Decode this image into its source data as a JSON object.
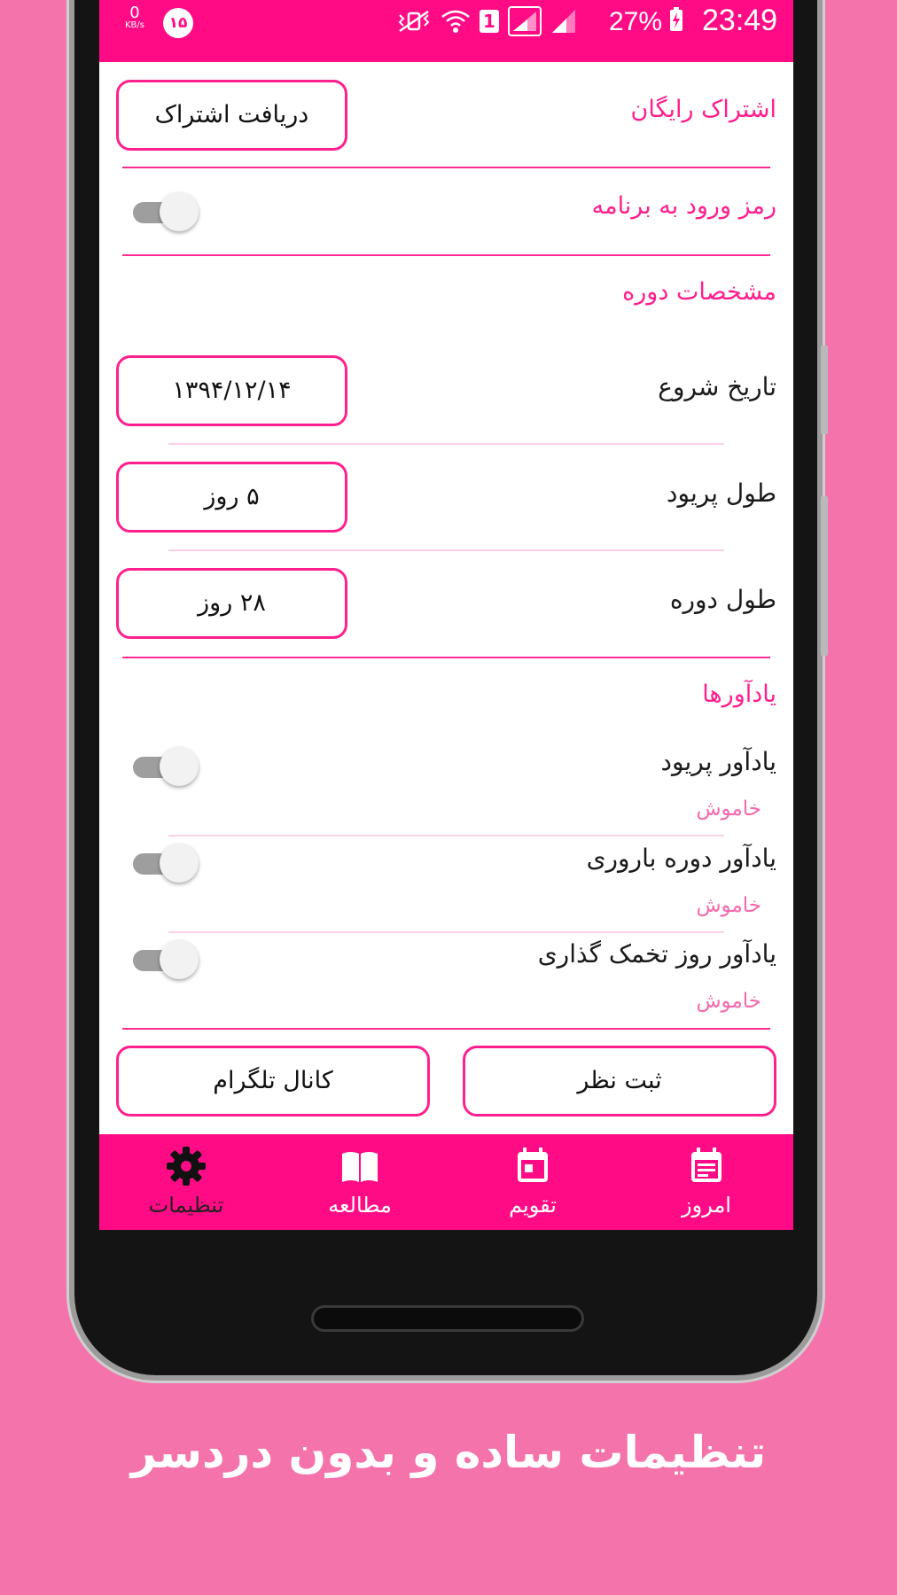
{
  "status_bar": {
    "speed_value": "0",
    "speed_unit": "KB/s",
    "notification_count": "۱۵",
    "sim_label": "1",
    "battery": "27%",
    "time": "23:49"
  },
  "settings": {
    "free_subscription": {
      "label": "اشتراک رایگان",
      "button": "دریافت اشتراک"
    },
    "app_password": {
      "label": "رمز ورود به برنامه",
      "enabled": false
    },
    "cycle_section": {
      "title": "مشخصات دوره"
    },
    "start_date": {
      "label": "تاریخ شروع",
      "value": "۱۳۹۴/۱۲/۱۴"
    },
    "period_length": {
      "label": "طول پریود",
      "value": "۵ روز"
    },
    "cycle_length": {
      "label": "طول دوره",
      "value": "۲۸ روز"
    },
    "reminders_section": {
      "title": "یادآورها"
    },
    "reminders": [
      {
        "label": "یادآور پریود",
        "status": "خاموش",
        "enabled": false
      },
      {
        "label": "یادآور دوره باروری",
        "status": "خاموش",
        "enabled": false
      },
      {
        "label": "یادآور روز تخمک گذاری",
        "status": "خاموش",
        "enabled": false
      }
    ],
    "feedback_button": "ثبت نظر",
    "telegram_button": "کانال تلگرام"
  },
  "bottom_nav": [
    {
      "label": "امروز",
      "icon": "today-icon",
      "active": false
    },
    {
      "label": "تقویم",
      "icon": "calendar-icon",
      "active": false
    },
    {
      "label": "مطالعه",
      "icon": "book-icon",
      "active": false
    },
    {
      "label": "تنظیمات",
      "icon": "gear-icon",
      "active": true
    }
  ],
  "caption": "تنظیمات ساده و بدون دردسر",
  "colors": {
    "background": "#f573ab",
    "accent": "#ff0b85",
    "accent_text": "#ff1f8e",
    "muted_status": "#f569ad"
  }
}
